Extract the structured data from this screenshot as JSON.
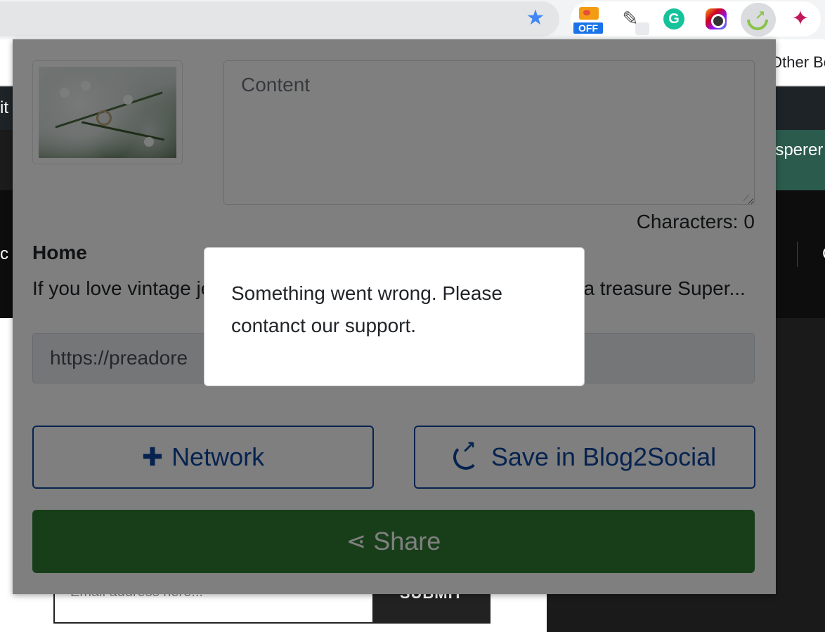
{
  "browser": {
    "extensions": [
      {
        "name": "image-tool-extension",
        "badge": "OFF"
      },
      {
        "name": "eyedropper-extension"
      },
      {
        "name": "grammarly-extension",
        "letter": "G"
      },
      {
        "name": "camera-extension"
      },
      {
        "name": "blog2social-extension"
      },
      {
        "name": "extensions-puzzle"
      }
    ],
    "bookmark_other": "Other Bo"
  },
  "site": {
    "topnav_text": "it",
    "green_button_text": "isperer",
    "menu_text": "c",
    "menu_char": "C",
    "email_placeholder": "Email address here...",
    "submit_label": "SUBMIT"
  },
  "popup": {
    "content_placeholder": "Content",
    "char_count_label": "Characters:",
    "char_count_value": "0",
    "post_title": "Home",
    "post_excerpt": "If you love vintage jewelry and want to get a piece of luxuryfind a treasure Super...",
    "url_value": "https://preadore",
    "network_button": "Network",
    "save_button": "Save in Blog2Social",
    "share_button": "Share"
  },
  "alert": {
    "message": "Something went wrong. Please contanct our support."
  },
  "colors": {
    "primary": "#0d47a1",
    "share_green": "#2e7d32",
    "overlay": "rgba(0,0,0,0.5)"
  }
}
